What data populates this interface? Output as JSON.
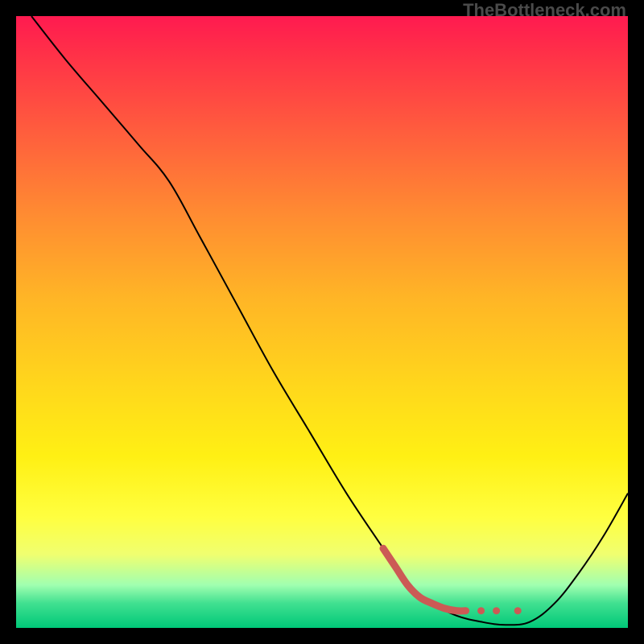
{
  "watermark": "TheBottleneck.com",
  "chart_data": {
    "type": "line",
    "title": "",
    "xlabel": "",
    "ylabel": "",
    "x_range": [
      0,
      100
    ],
    "y_range": [
      0,
      100
    ],
    "series": [
      {
        "name": "black-curve",
        "color": "#000000",
        "stroke_width": 2,
        "points": [
          {
            "x": 2.5,
            "y": 100
          },
          {
            "x": 8,
            "y": 93
          },
          {
            "x": 14,
            "y": 86
          },
          {
            "x": 20,
            "y": 79
          },
          {
            "x": 25,
            "y": 73
          },
          {
            "x": 30,
            "y": 64
          },
          {
            "x": 36,
            "y": 53
          },
          {
            "x": 42,
            "y": 42
          },
          {
            "x": 48,
            "y": 32
          },
          {
            "x": 54,
            "y": 22
          },
          {
            "x": 60,
            "y": 13
          },
          {
            "x": 64,
            "y": 7
          },
          {
            "x": 68,
            "y": 4
          },
          {
            "x": 72,
            "y": 2
          },
          {
            "x": 76,
            "y": 1
          },
          {
            "x": 80,
            "y": 0.5
          },
          {
            "x": 84,
            "y": 1
          },
          {
            "x": 88,
            "y": 4
          },
          {
            "x": 92,
            "y": 9
          },
          {
            "x": 96,
            "y": 15
          },
          {
            "x": 100,
            "y": 22
          }
        ]
      },
      {
        "name": "red-segment",
        "color": "#cc5a55",
        "stroke_width": 9,
        "linecap": "round",
        "points": [
          {
            "x": 60,
            "y": 13
          },
          {
            "x": 62,
            "y": 10
          },
          {
            "x": 64,
            "y": 7
          },
          {
            "x": 66,
            "y": 5
          },
          {
            "x": 68,
            "y": 4
          },
          {
            "x": 70,
            "y": 3.2
          },
          {
            "x": 72,
            "y": 2.8
          },
          {
            "x": 73.5,
            "y": 2.8
          }
        ]
      }
    ],
    "markers": [
      {
        "name": "red-dot-1",
        "x": 76,
        "y": 2.8,
        "r": 4.5,
        "color": "#cc5a55"
      },
      {
        "name": "red-dot-2",
        "x": 78.5,
        "y": 2.8,
        "r": 4.5,
        "color": "#cc5a55"
      },
      {
        "name": "red-dot-3",
        "x": 82,
        "y": 2.8,
        "r": 4.5,
        "color": "#cc5a55"
      }
    ]
  }
}
